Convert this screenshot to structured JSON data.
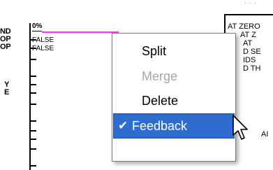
{
  "left_edge": {
    "rows": [
      {
        "text": "ND"
      },
      {
        "text": "OP"
      },
      {
        "text": "OP"
      },
      {
        "text": "Y"
      },
      {
        "text": "E"
      }
    ]
  },
  "track": {
    "top_value": "0%",
    "values": [
      "FALSE",
      "FALSE"
    ]
  },
  "right_panel": {
    "header": "· · ·",
    "lines": [
      "AT ZERO",
      "AT Z",
      "AT",
      "D SE",
      "IDS",
      "D TH",
      "AI"
    ]
  },
  "context_menu": {
    "items": [
      {
        "label": "Split",
        "enabled": true,
        "checked": false
      },
      {
        "label": "Merge",
        "enabled": false,
        "checked": false
      },
      {
        "label": "Delete",
        "enabled": true,
        "checked": false
      },
      {
        "label": "Feedback",
        "enabled": true,
        "checked": true
      }
    ],
    "check_glyph": "✔"
  },
  "colors": {
    "menu_selection": "#2e6ccf",
    "disabled_text": "#a6a6a6",
    "magenta_line": "#ff33ff"
  }
}
